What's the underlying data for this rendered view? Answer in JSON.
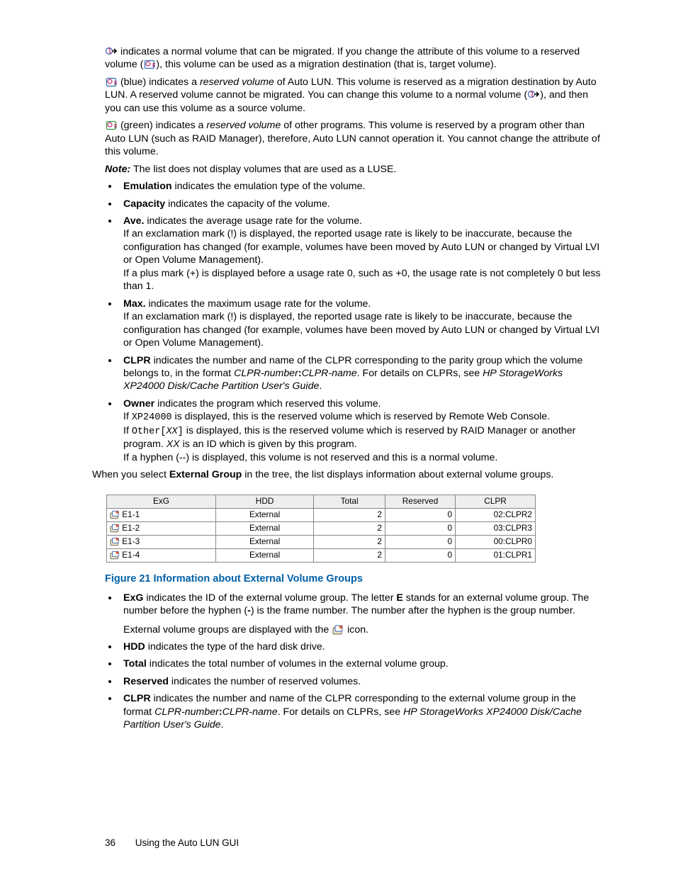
{
  "p1_a": " indicates a normal volume that can be migrated.  If you change the attribute of this volume to a reserved volume (",
  "p1_b": "), this volume can be used as a migration destination (that is, target volume).",
  "p2_a": " (blue) indicates a ",
  "p2_rv": "reserved volume",
  "p2_b": " of Auto LUN. This volume is reserved as a migration destination by Auto LUN. A reserved volume cannot be migrated.  You can change this volume to a normal volume (",
  "p2_c": "), and then you can use this volume as a source volume.",
  "p3_a": " (green) indicates a ",
  "p3_rv": "reserved volume",
  "p3_b": " of other programs.  This volume is reserved by a program other than Auto LUN (such as RAID Manager), therefore, Auto LUN cannot operation it.  You cannot change the attribute of this volume.",
  "note_label": "Note:",
  "note_text": "  The list does not display volumes that are used as a LUSE.",
  "li_em_b": "Emulation",
  "li_em_t": " indicates the emulation type of the volume.",
  "li_cap_b": "Capacity",
  "li_cap_t": " indicates the capacity of the volume.",
  "li_ave_b": "Ave.",
  "li_ave_t1": "  indicates the average usage rate for the volume.",
  "li_ave_t2": "If an exclamation mark (!) is displayed, the reported usage rate is likely to be inaccurate, because the configuration has changed (for example, volumes have been moved by Auto LUN or changed by Virtual LVI or Open Volume Management).",
  "li_ave_t3": "If a plus mark (+) is displayed before a usage rate 0, such as +0, the usage rate is not completely 0 but less than 1.",
  "li_max_b": "Max.",
  "li_max_t1": "  indicates the maximum usage rate for the volume.",
  "li_max_t2": "If an exclamation mark (!) is displayed, the reported usage rate is likely to be inaccurate, because the configuration has changed (for example, volumes have been moved by Auto LUN or changed by Virtual LVI or Open Volume Management).",
  "li_clpr_b": "CLPR",
  "li_clpr_t1": " indicates the number and name of the CLPR corresponding to the parity group which the volume belongs to, in the format ",
  "li_clpr_fmt1": "CLPR-number",
  "li_clpr_colon": ":",
  "li_clpr_fmt2": "CLPR-name",
  "li_clpr_t2": ".  For details on CLPRs, see ",
  "li_clpr_ref": "HP StorageWorks XP24000 Disk/Cache Partition User's Guide",
  "li_clpr_dot": ".",
  "li_own_b": "Owner",
  "li_own_t1": " indicates the program which reserved this volume.",
  "li_own_t2a": "If ",
  "li_own_mono1": "XP24000",
  "li_own_t2b": " is displayed, this is the reserved volume which is reserved by Remote Web Console.",
  "li_own_t3a": "If ",
  "li_own_mono2a": "Other[",
  "li_own_xx": "XX",
  "li_own_mono2b": "]",
  "li_own_t3b": " is displayed, this is the reserved volume which is reserved by RAID Manager or another program.  ",
  "li_own_xx2": "XX",
  "li_own_t3c": " is an ID which is given by this program.",
  "li_own_t4": "If a hyphen (--) is displayed, this volume is not reserved and this is a normal volume.",
  "ext_intro_a": "When you select ",
  "ext_intro_b": "External Group",
  "ext_intro_c": " in the tree, the list displays information about external volume groups.",
  "table": {
    "headers": {
      "exg": "ExG",
      "hdd": "HDD",
      "total": "Total",
      "reserved": "Reserved",
      "clpr": "CLPR"
    },
    "rows": [
      {
        "exg": "E1-1",
        "hdd": "External",
        "total": "2",
        "reserved": "0",
        "clpr": "02:CLPR2"
      },
      {
        "exg": "E1-2",
        "hdd": "External",
        "total": "2",
        "reserved": "0",
        "clpr": "03:CLPR3"
      },
      {
        "exg": "E1-3",
        "hdd": "External",
        "total": "2",
        "reserved": "0",
        "clpr": "00:CLPR0"
      },
      {
        "exg": "E1-4",
        "hdd": "External",
        "total": "2",
        "reserved": "0",
        "clpr": "01:CLPR1"
      }
    ]
  },
  "fig_caption": "Figure 21 Information about External Volume Groups",
  "li2_exg_b": "ExG",
  "li2_exg_t1": " indicates the ID of the external volume group.  The letter ",
  "li2_exg_E": "E",
  "li2_exg_t2": " stands for an external volume group.  The number before the hyphen (",
  "li2_exg_hy": "-",
  "li2_exg_t3": ") is the frame number.  The number after the hyphen is the group number.",
  "li2_exg_t4a": "External volume groups are displayed with the ",
  "li2_exg_t4b": " icon.",
  "li2_hdd_b": "HDD",
  "li2_hdd_t": " indicates the type of the hard disk drive.",
  "li2_tot_b": "Total",
  "li2_tot_t": " indicates the total number of volumes in the external volume group.",
  "li2_res_b": "Reserved",
  "li2_res_t": " indicates the number of reserved volumes.",
  "li2_clpr_b": "CLPR",
  "li2_clpr_t1": " indicates the number and name of the CLPR corresponding to the external volume group in the format ",
  "li2_clpr_t2": ".  For details on CLPRs, see ",
  "li2_clpr_ref": "HP StorageWorks XP24000 Disk/Cache Partition User's Guide",
  "footer_page": "36",
  "footer_text": "Using the Auto LUN GUI"
}
